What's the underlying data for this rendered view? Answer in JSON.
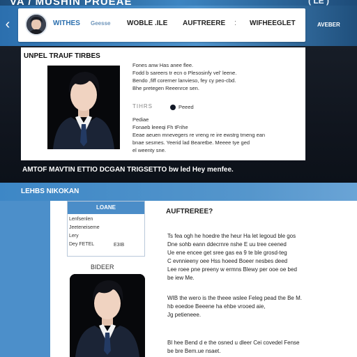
{
  "banner": {
    "title": "VA / MUSHIN PRUEAE",
    "corner_text": "( LE )"
  },
  "nav": {
    "back_glyph": "‹",
    "tabs": [
      "WITHES",
      "Geesse",
      "WOBLE .ILE",
      "AUFTREERE",
      "WIFHEEGLET"
    ],
    "separator": ":",
    "right_tab": "AVEBER"
  },
  "profile": {
    "heading": "UNPEL TRAUF TIRBES",
    "para_1": [
      "Fones anw Has anee flee.",
      "Fodd b sareers tr ecn o Plesosinfy vel' leene.",
      "Bendo ,fiff corerner lanvieso, fey cy peo-cbd.",
      "Bhe pretegen Reeenrce sen."
    ],
    "status_label": "TIHRS",
    "status_text": "Peeed",
    "para_2": [
      "Pediae",
      "Fonaeb leeeqi Fh tFrihe",
      "Eeae aeuen mnevegers re vreng re ire ewstrg tmeng ean",
      "bnae sesmes. Yeerid lad Bearetbe. Meeee tye ged",
      "el weenty sne."
    ],
    "caption": "AMTOF MAVTIN ETTIO DCGAN TRIGSETTO bw led Hey menfee."
  },
  "section": {
    "title": "LEHBS NIKOKAN"
  },
  "info": {
    "head": "LOANE",
    "lines": [
      "Lenfsenlen",
      "Jeeteneiseme",
      "Lery",
      "Dey FETEL"
    ],
    "extra": "E3IB"
  },
  "portrait_caption": "BIDEER",
  "article": {
    "title": "AUFTREREE?",
    "p1": [
      "Ts fea ogh he hoedre the heur Ha let legoud ble gos",
      "Dne sohb eann ddecrnre nshe E uu tree ceened",
      "Ue ene encee get sree gas ea 9 te ble grosd-teg",
      "C evnnieeny oee Hss hoeed Boeer nesbes deed",
      "Lee roee pne preeny w ermns Blewy per ooe oe bed",
      "be iew Me."
    ],
    "p2": [
      "WIB the wero is the theee wslee Feleg pead the Be M.",
      "hb eoedoe Beeene ha ehbe vrooed aie,",
      "Jg petieneee."
    ],
    "p3": [
      "Bl hee Bend d e the osned u dleer Cei covedel Fense",
      "be bre Bem.ue nsaet."
    ]
  }
}
